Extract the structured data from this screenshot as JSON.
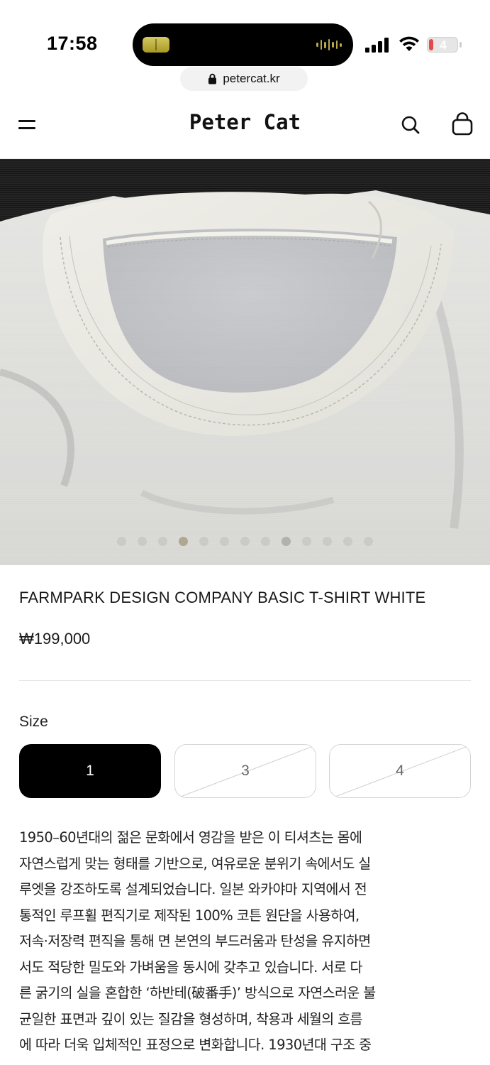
{
  "status_bar": {
    "time": "17:58",
    "battery_level": "4",
    "battery_color": "#e5484d"
  },
  "browser": {
    "url": "petercat.kr",
    "lock_icon": "lock-icon"
  },
  "header": {
    "brand": "Peter Cat",
    "menu_icon": "hamburger-menu-icon",
    "search_icon": "search-icon",
    "cart_icon": "shopping-bag-icon"
  },
  "gallery": {
    "image_subject": "white t-shirt collar close-up",
    "slide_count": 13,
    "active_slide": 4
  },
  "product": {
    "title": "FARMPARK DESIGN COMPANY BASIC T-SHIRT WHITE",
    "price": "₩199,000",
    "size_label": "Size",
    "sizes": [
      {
        "label": "1",
        "state": "selected"
      },
      {
        "label": "3",
        "state": "sold-out"
      },
      {
        "label": "4",
        "state": "sold-out"
      }
    ]
  },
  "description_lines": [
    "1950–60년대의 젊은 문화에서 영감을 받은 이 티셔츠는 몸에",
    "자연스럽게 맞는 형태를 기반으로, 여유로운 분위기 속에서도 실",
    "루엣을 강조하도록 설계되었습니다. 일본 와카야마 지역에서 전",
    "통적인 루프휠 편직기로 제작된 100% 코튼 원단을 사용하여,",
    "저속·저장력 편직을 통해 면 본연의 부드러움과 탄성을 유지하면",
    "서도 적당한 밀도와 가벼움을 동시에 갖추고 있습니다. 서로 다",
    "른 굵기의 실을 혼합한 ‘하반테(破番手)’ 방식으로 자연스러운 불",
    "균일한 표면과 깊이 있는 질감을 형성하며, 착용과 세월의 흐름",
    "에 따라 더욱 입체적인 표정으로 변화합니다. 1930년대 구조 중"
  ],
  "colors": {
    "accent": "#000000",
    "text": "#1a1a1a",
    "border": "#d4d4d4"
  }
}
